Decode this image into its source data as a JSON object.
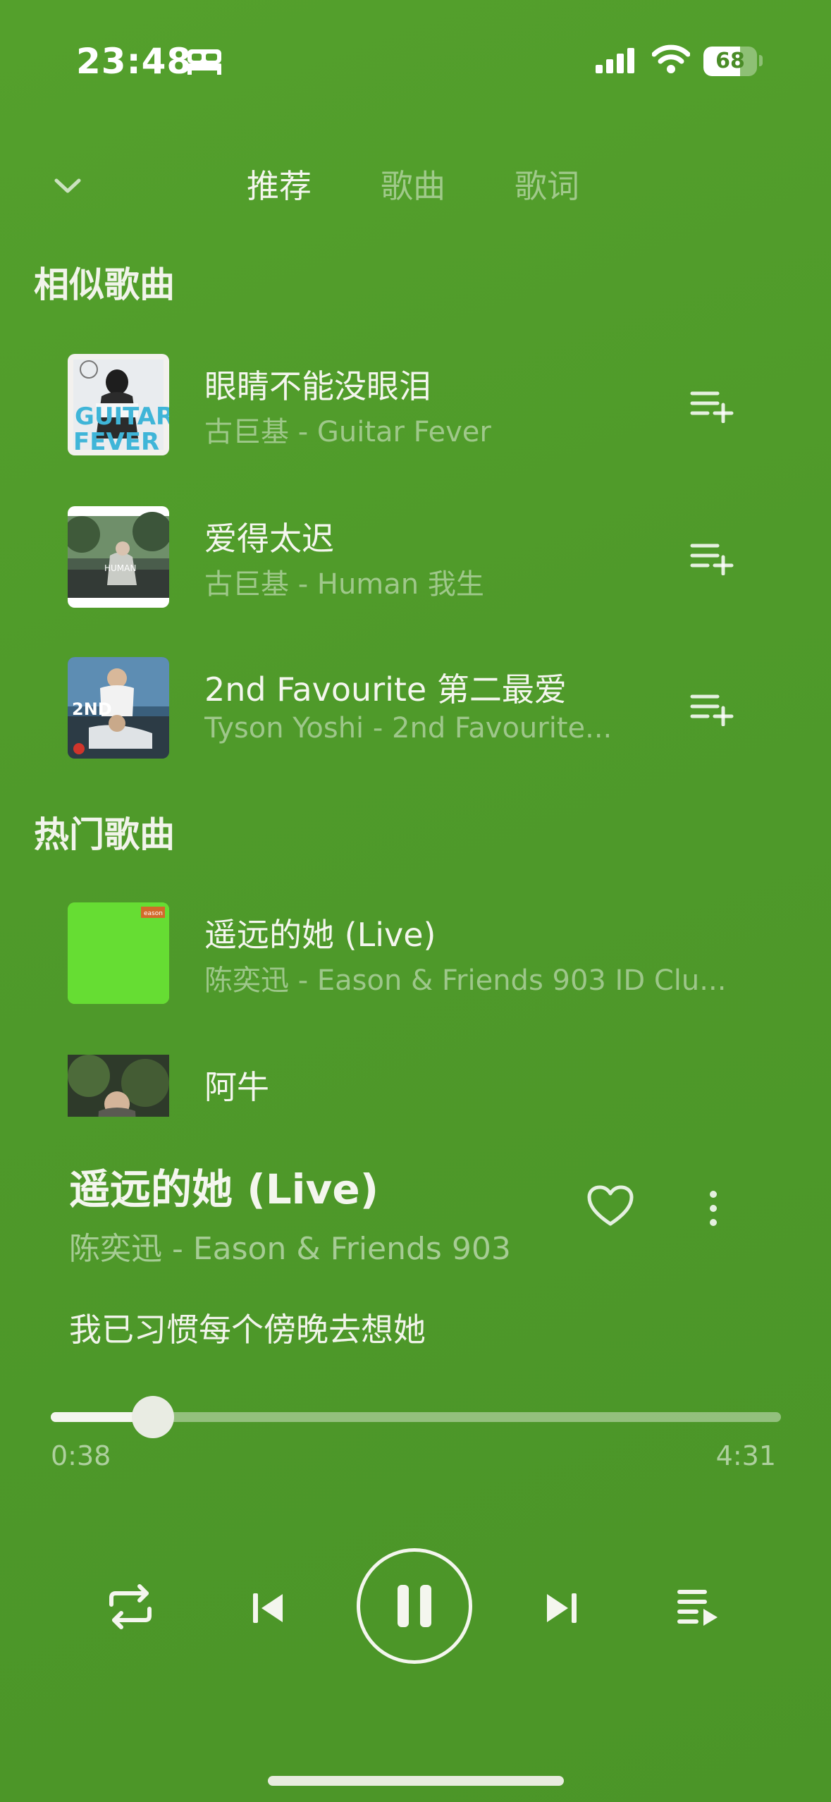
{
  "status_bar": {
    "time": "23:48",
    "battery": "68",
    "battery_level": 0.68,
    "icons": [
      "bed-icon",
      "cellular-signal-icon",
      "wifi-icon",
      "battery-icon"
    ]
  },
  "header": {
    "collapse_icon": "chevron-down-icon",
    "tabs": [
      {
        "label": "推荐",
        "active": true
      },
      {
        "label": "歌曲",
        "active": false
      },
      {
        "label": "歌词",
        "active": false
      }
    ]
  },
  "similar": {
    "title": "相似歌曲",
    "songs": [
      {
        "title": "眼睛不能没眼泪",
        "subtitle": "古巨基 - Guitar Fever",
        "cover_text": "GUITAR FEVER"
      },
      {
        "title": "爱得太迟",
        "subtitle": "古巨基 - Human 我生",
        "cover_text": "HUMAN"
      },
      {
        "title": "2nd Favourite 第二最爱",
        "subtitle": "Tyson Yoshi - 2nd Favourite...",
        "cover_text": "2ND"
      }
    ]
  },
  "hot": {
    "title": "热门歌曲",
    "songs": [
      {
        "title": "遥远的她 (Live)",
        "subtitle": "陈奕迅 - Eason & Friends 903 ID Clu..."
      },
      {
        "title": "阿牛",
        "subtitle": ""
      }
    ]
  },
  "now_playing": {
    "title": "遥远的她 (Live)",
    "subtitle": "陈奕迅 - Eason & Friends 903",
    "lyric": "我已习惯每个傍晚去想她",
    "current_time": "0:38",
    "total_time": "4:31",
    "progress": 0.1402
  },
  "controls": {
    "icons": [
      "repeat-icon",
      "previous-icon",
      "pause-icon",
      "next-icon",
      "playlist-icon"
    ]
  },
  "colors": {
    "background": "#4f9a2a",
    "text": "#f4f6ee",
    "muted_text": "rgba(255,255,255,0.45)"
  }
}
